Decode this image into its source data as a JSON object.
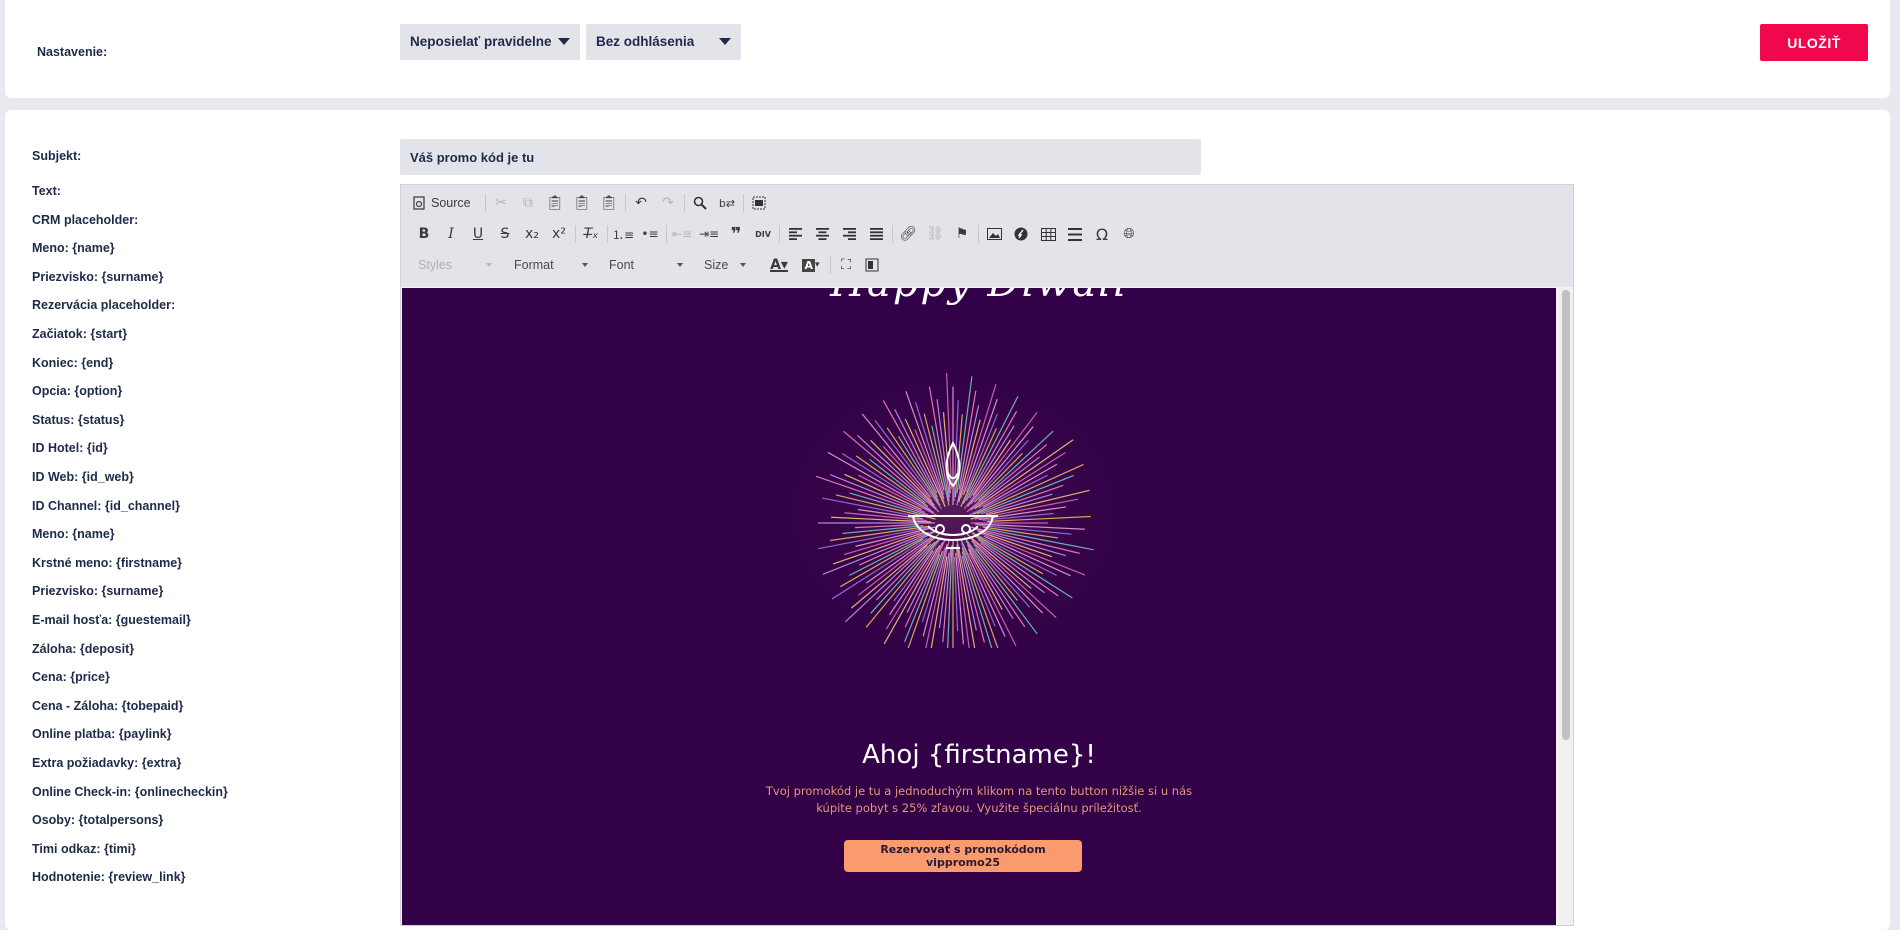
{
  "settings": {
    "label": "Nastavenie:",
    "frequency_select": "Neposielať pravidelne",
    "unsubscribe_select": "Bez odhlásenia",
    "save_label": "ULOŽIŤ"
  },
  "subject": {
    "label": "Subjekt:",
    "value": "Váš promo kód je tu"
  },
  "placeholders": [
    "Text:",
    "CRM placeholder:",
    "Meno: {name}",
    "Priezvisko: {surname}",
    "Rezervácia placeholder:",
    "Začiatok: {start}",
    "Koniec: {end}",
    "Opcia: {option}",
    "Status: {status}",
    "ID Hotel: {id}",
    "ID Web: {id_web}",
    "ID Channel: {id_channel}",
    "Meno: {name}",
    "Krstné meno: {firstname}",
    "Priezvisko: {surname}",
    "E-mail hosťa: {guestemail}",
    "Záloha: {deposit}",
    "Cena: {price}",
    "Cena - Záloha: {tobepaid}",
    "Online platba: {paylink}",
    "Extra požiadavky: {extra}",
    "Online Check-in: {onlinecheckin}",
    "Osoby: {totalpersons}",
    "Timi odkaz: {timi}",
    "Hodnotenie: {review_link}"
  ],
  "toolbar": {
    "source_label": "Source",
    "styles_label": "Styles",
    "format_label": "Format",
    "font_label": "Font",
    "size_label": "Size"
  },
  "email": {
    "header_script": "Happy Diwali",
    "greeting": "Ahoj {firstname}!",
    "body": "Tvoj promokód je tu a jednoduchým klikom na tento button nižšie si u nás kúpite pobyt s 25% zľavou. Využite špeciálnu príležitosť.",
    "cta": "Rezervovať s promokódom vippromo25",
    "colors": {
      "background": "#330147",
      "cta": "#f99b6c",
      "body_text": "#e09a7a"
    }
  },
  "colors": {
    "accent": "#f0074c",
    "field_bg": "#e3e4ea",
    "label_text": "#1e2a4a"
  }
}
